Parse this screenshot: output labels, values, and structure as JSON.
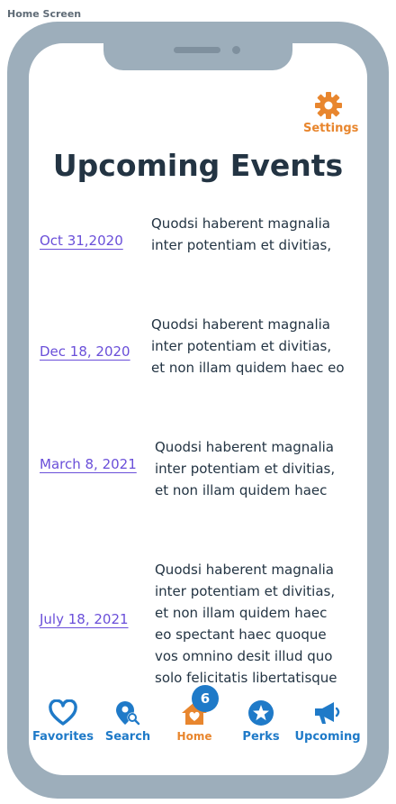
{
  "frame_label": "Home Screen",
  "settings": {
    "label": "Settings",
    "icon": "gear-icon"
  },
  "page_title": "Upcoming Events",
  "colors": {
    "accent": "#e8862e",
    "primary": "#1f7ac8",
    "link": "#6a4fd9",
    "frame": "#9daebb"
  },
  "events": [
    {
      "date": "Oct 31,2020",
      "lines": [
        "Quodsi haberent magnalia",
        "inter potentiam et divitias,"
      ]
    },
    {
      "date": "Dec 18, 2020",
      "lines": [
        "Quodsi haberent magnalia",
        "inter potentiam et divitias,",
        "et non illam quidem haec eo"
      ]
    },
    {
      "date": "March 8, 2021",
      "lines": [
        "Quodsi haberent magnalia",
        "inter potentiam et divitias,",
        "et non illam quidem haec"
      ]
    },
    {
      "date": "July 18, 2021",
      "lines": [
        "Quodsi haberent magnalia",
        "inter potentiam et divitias,",
        "et non illam quidem haec",
        "eo spectant haec quoque",
        "vos omnino desit illud quo",
        "solo felicitatis libertatisque"
      ]
    }
  ],
  "tabbar": {
    "badge_count": "6",
    "tabs": [
      {
        "label": "Favorites",
        "icon": "heart-icon"
      },
      {
        "label": "Search",
        "icon": "location-search-icon"
      },
      {
        "label": "Home",
        "icon": "home-heart-icon",
        "active": true
      },
      {
        "label": "Perks",
        "icon": "star-badge-icon"
      },
      {
        "label": "Upcoming",
        "icon": "megaphone-icon"
      }
    ]
  }
}
